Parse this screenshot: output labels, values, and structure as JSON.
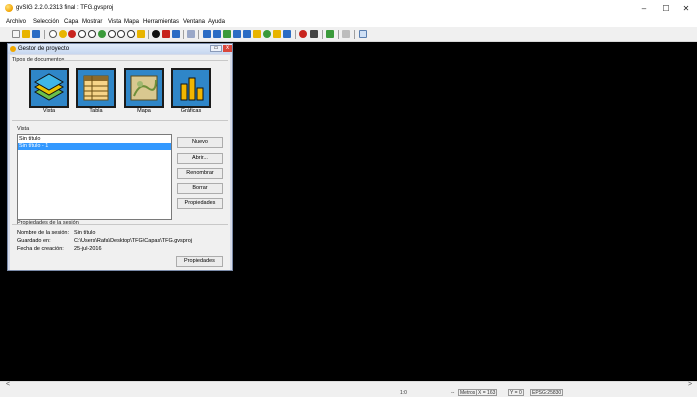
{
  "window": {
    "title": "gvSIG 2.2.0.2313 final : TFG.gvsproj",
    "minimize_glyph": "–",
    "maximize_glyph": "☐",
    "close_glyph": "✕"
  },
  "menu": [
    "Archivo",
    "Selección",
    "Capa",
    "Mostrar",
    "Vista",
    "Mapa",
    "Herramientas",
    "Ventana",
    "Ayuda"
  ],
  "toolbar": {
    "icons": [
      "new-icon",
      "open-icon",
      "save-icon",
      "pan-icon",
      "zoom-icon",
      "zoom-icon",
      "zoom-in-icon",
      "zoom-out-icon",
      "zoom-full-icon",
      "zoom-prev-icon",
      "zoom-next-icon",
      "zoom-select-icon",
      "zoom-layer-icon",
      "info-icon",
      "measure-icon",
      "area-icon",
      "hyperlink-icon",
      "select-icon",
      "select-rect-icon",
      "select-polygon-icon",
      "select-circle-icon",
      "select-buffer-icon",
      "filter-icon",
      "globe-icon",
      "graph-icon",
      "edit-icon",
      "stop-icon",
      "tool-icon",
      "layer-icon",
      "grid-icon",
      "table-icon"
    ],
    "colors": {
      "red": "#c8241e",
      "blue": "#2b6cc4",
      "yellow": "#e8b400",
      "green": "#3a9a3a"
    }
  },
  "project_manager": {
    "title": "Gestor de proyecto",
    "minimize_label": "▭",
    "close_label": "x",
    "doc_types_label": "Tipos de documentos",
    "doc_types": [
      {
        "label": "Vista",
        "icon": "view-icon"
      },
      {
        "label": "Tabla",
        "icon": "table-icon"
      },
      {
        "label": "Mapa",
        "icon": "map-icon"
      },
      {
        "label": "Gráficas",
        "icon": "chart-icon"
      }
    ],
    "docs_section_label": "Vista",
    "docs": [
      {
        "name": "Sin título",
        "selected": false
      },
      {
        "name": "Sin título - 1",
        "selected": true
      }
    ],
    "buttons": {
      "new": "Nuevo",
      "open": "Abrir...",
      "rename": "Renombrar",
      "delete": "Borrar",
      "properties": "Propiedades"
    },
    "session": {
      "section_label": "Propiedades de la sesión",
      "name_label": "Nombre de la sesión:",
      "name_value": "Sin título",
      "saved_label": "Guardado en:",
      "saved_value": "C:\\Users\\Rafa\\Desktop\\TFG\\Capas\\TFG.gvsproj",
      "date_label": "Fecha de creación:",
      "date_value": "25-jul-2016",
      "properties_button": "Propiedades"
    }
  },
  "status": {
    "scale": "1:0",
    "units_sep": "--",
    "units": "Metros",
    "x": "X = 163",
    "y": "Y = 0",
    "epsg": "EPSG:25830"
  },
  "scroll": {
    "left_glyph": "<",
    "right_glyph": ">"
  }
}
